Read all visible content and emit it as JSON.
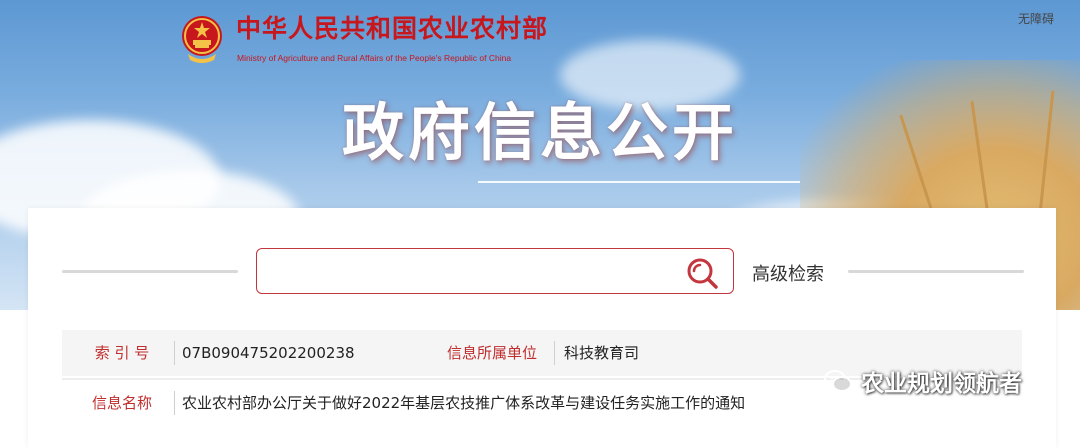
{
  "header": {
    "ministry_name_cn": "中华人民共和国农业农村部",
    "ministry_name_en": "Ministry of Agriculture and Rural Affairs of the People's Republic of China",
    "accessibility_link": "无障碍",
    "page_heading": "政府信息公开"
  },
  "search": {
    "value": "",
    "placeholder": "",
    "advanced_label": "高级检索"
  },
  "info": {
    "index_label": "索 引 号",
    "index_value": "07B090475202200238",
    "unit_label": "信息所属单位",
    "unit_value": "科技教育司",
    "name_label": "信息名称",
    "name_value": "农业农村部办公厅关于做好2022年基层农技推广体系改革与建设任务实施工作的通知"
  },
  "watermark": {
    "text": "农业规划领航者"
  },
  "colors": {
    "brand_red": "#c8161d",
    "label_red": "#c02d2d",
    "search_border": "#c4363e"
  }
}
